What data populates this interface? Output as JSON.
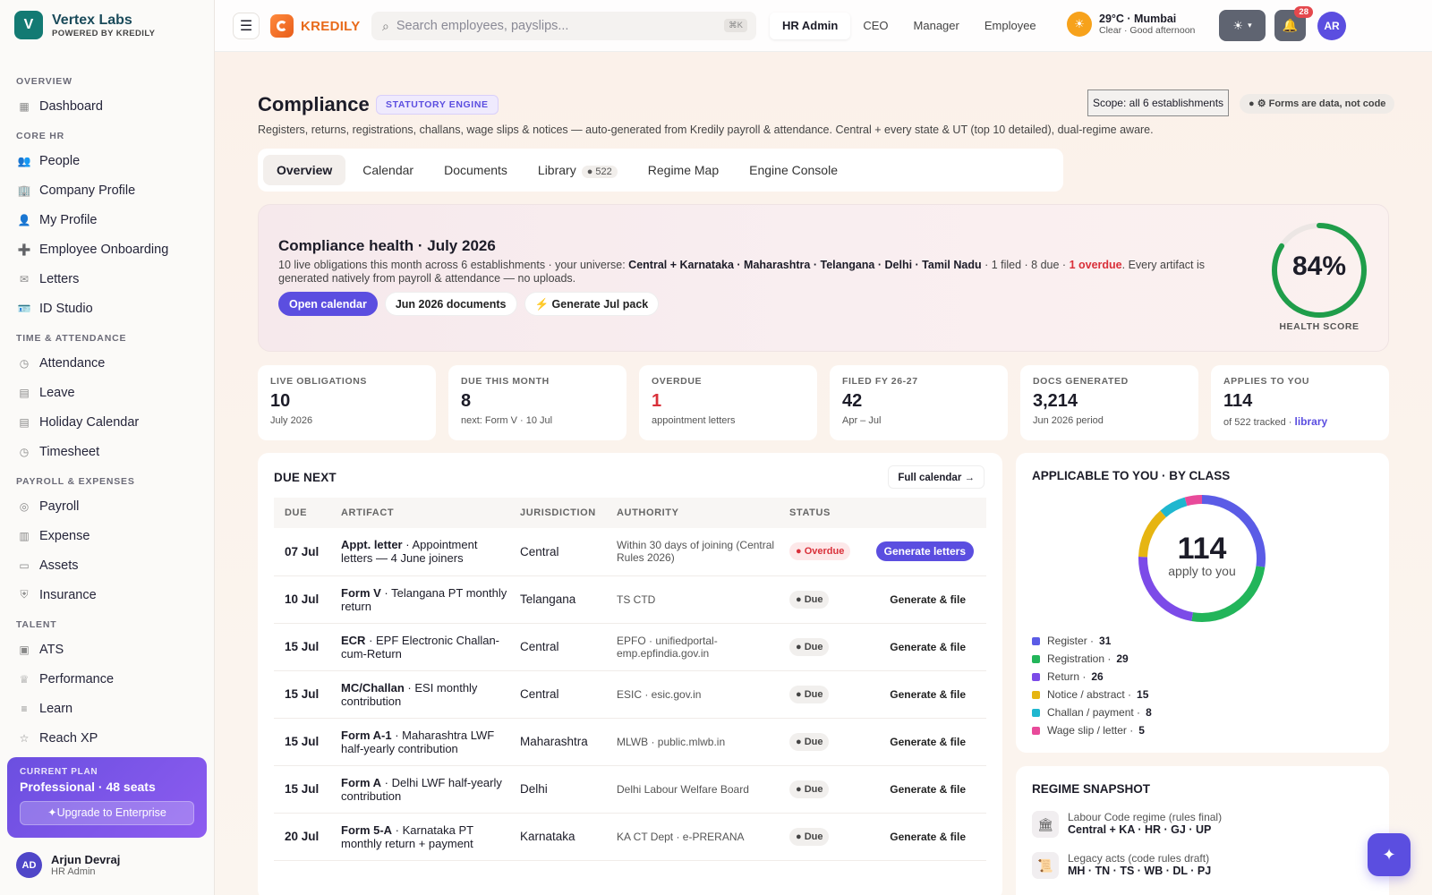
{
  "brand": {
    "logo_letter": "V",
    "name": "Vertex Labs",
    "sub": "POWERED BY KREDILY"
  },
  "nav": {
    "sections": [
      {
        "title": "OVERVIEW",
        "items": [
          {
            "label": "Dashboard",
            "icon": "grid-icon"
          }
        ]
      },
      {
        "title": "CORE HR",
        "items": [
          {
            "label": "People",
            "icon": "people-icon"
          },
          {
            "label": "Company Profile",
            "icon": "building-icon"
          },
          {
            "label": "My Profile",
            "icon": "user-icon"
          },
          {
            "label": "Employee Onboarding",
            "icon": "user-plus-icon"
          },
          {
            "label": "Letters",
            "icon": "mail-icon"
          },
          {
            "label": "ID Studio",
            "icon": "id-card-icon"
          }
        ]
      },
      {
        "title": "TIME & ATTENDANCE",
        "items": [
          {
            "label": "Attendance",
            "icon": "clock-icon"
          },
          {
            "label": "Leave",
            "icon": "calendar-icon"
          },
          {
            "label": "Holiday Calendar",
            "icon": "calendar-icon"
          },
          {
            "label": "Timesheet",
            "icon": "clock-icon"
          }
        ]
      },
      {
        "title": "PAYROLL & EXPENSES",
        "items": [
          {
            "label": "Payroll",
            "icon": "coin-icon"
          },
          {
            "label": "Expense",
            "icon": "receipt-icon"
          },
          {
            "label": "Assets",
            "icon": "monitor-icon"
          },
          {
            "label": "Insurance",
            "icon": "shield-icon"
          }
        ]
      },
      {
        "title": "TALENT",
        "items": [
          {
            "label": "ATS",
            "icon": "briefcase-icon"
          },
          {
            "label": "Performance",
            "icon": "trophy-icon"
          },
          {
            "label": "Learn",
            "icon": "book-icon"
          },
          {
            "label": "Reach XP",
            "icon": "star-icon"
          }
        ]
      }
    ]
  },
  "plan": {
    "label": "CURRENT PLAN",
    "name": "Professional · 48 seats",
    "button": "✦Upgrade to Enterprise"
  },
  "user": {
    "initials": "AD",
    "name": "Arjun Devraj",
    "role": "HR Admin"
  },
  "topbar": {
    "app_name": "KREDILY",
    "search_placeholder": "Search employees, payslips...",
    "search_shortcut": "⌘K",
    "roles": [
      "HR Admin",
      "CEO",
      "Manager",
      "Employee"
    ],
    "active_role": "HR Admin",
    "weather_main": "29°C · Mumbai",
    "weather_sub": "Clear · Good afternoon",
    "notifications": "28",
    "avatar": "AR"
  },
  "page": {
    "title": "Compliance",
    "tag": "STATUTORY ENGINE",
    "scope": "Scope: all 6 establishments",
    "forms_note": "● ⚙ Forms are data, not code",
    "subtitle": "Registers, returns, registrations, challans, wage slips & notices — auto-generated from Kredily payroll & attendance. Central + every state & UT (top 10 detailed), dual-regime aware.",
    "tabs": [
      "Overview",
      "Calendar",
      "Documents",
      "Library",
      "Regime Map",
      "Engine Console"
    ],
    "library_count": "● 522"
  },
  "health": {
    "title": "Compliance health · July 2026",
    "text_pre": "10 live obligations this month across 6 establishments · your universe: ",
    "text_bold": "Central + Karnataka · Maharashtra · Telangana · Delhi · Tamil Nadu",
    "text_mid": " · 1 filed · 8 due · ",
    "text_red": "1 overdue",
    "text_post": ". Every artifact is generated natively from payroll & attendance — no uploads.",
    "buttons": [
      "Open calendar",
      "Jun 2026 documents",
      "⚡ Generate Jul pack"
    ],
    "score": 84,
    "score_text": "84%",
    "score_label": "HEALTH SCORE",
    "score_color": "#1f9d4a"
  },
  "kpis": [
    {
      "label": "LIVE OBLIGATIONS",
      "value": "10",
      "sub": "July 2026"
    },
    {
      "label": "DUE THIS MONTH",
      "value": "8",
      "sub": "next: Form V · 10 Jul"
    },
    {
      "label": "OVERDUE",
      "value": "1",
      "sub": "appointment letters"
    },
    {
      "label": "FILED FY 26-27",
      "value": "42",
      "sub": "Apr – Jul"
    },
    {
      "label": "DOCS GENERATED",
      "value": "3,214",
      "sub": "Jun 2026 period"
    },
    {
      "label": "APPLIES TO YOU",
      "value": "114",
      "sub": "of 522 tracked · ",
      "link": "library"
    }
  ],
  "due_next": {
    "title": "DUE NEXT",
    "full_calendar": "Full calendar →",
    "columns": [
      "DUE",
      "ARTIFACT",
      "JURISDICTION",
      "AUTHORITY",
      "STATUS",
      ""
    ],
    "rows": [
      {
        "due": "07 Jul",
        "form": "Appt. letter",
        "desc": " · Appointment letters — 4 June joiners",
        "jurisdiction": "Central",
        "authority": "Within 30 days of joining (Central Rules 2026)",
        "status": "● Overdue",
        "overdue": true,
        "action": "Generate letters"
      },
      {
        "due": "10 Jul",
        "form": "Form V",
        "desc": " · Telangana PT monthly return",
        "jurisdiction": "Telangana",
        "authority": "TS CTD",
        "status": "● Due",
        "overdue": false,
        "action": "Generate & file"
      },
      {
        "due": "15 Jul",
        "form": "ECR",
        "desc": " · EPF Electronic Challan-cum-Return",
        "jurisdiction": "Central",
        "authority": "EPFO · unifiedportal-emp.epfindia.gov.in",
        "status": "● Due",
        "overdue": false,
        "action": "Generate & file"
      },
      {
        "due": "15 Jul",
        "form": "MC/Challan",
        "desc": " · ESI monthly contribution",
        "jurisdiction": "Central",
        "authority": "ESIC · esic.gov.in",
        "status": "● Due",
        "overdue": false,
        "action": "Generate & file"
      },
      {
        "due": "15 Jul",
        "form": "Form A-1",
        "desc": " · Maharashtra LWF half-yearly contribution",
        "jurisdiction": "Maharashtra",
        "authority": "MLWB · public.mlwb.in",
        "status": "● Due",
        "overdue": false,
        "action": "Generate & file"
      },
      {
        "due": "15 Jul",
        "form": "Form A",
        "desc": " · Delhi LWF half-yearly contribution",
        "jurisdiction": "Delhi",
        "authority": "Delhi Labour Welfare Board",
        "status": "● Due",
        "overdue": false,
        "action": "Generate & file"
      },
      {
        "due": "20 Jul",
        "form": "Form 5-A",
        "desc": " · Karnataka PT monthly return + payment",
        "jurisdiction": "Karnataka",
        "authority": "KA CT Dept · e-PRERANA",
        "status": "● Due",
        "overdue": false,
        "action": "Generate & file"
      }
    ]
  },
  "applicable": {
    "title": "APPLICABLE TO YOU · BY CLASS",
    "total": "114",
    "total_sub": "apply to you",
    "classes": [
      {
        "label": "Register ·",
        "value": 31,
        "color": "#5b5ce6"
      },
      {
        "label": "Registration ·",
        "value": 29,
        "color": "#22b55a"
      },
      {
        "label": "Return ·",
        "value": 26,
        "color": "#7c4be8"
      },
      {
        "label": "Notice / abstract ·",
        "value": 15,
        "color": "#e6b512"
      },
      {
        "label": "Challan / payment ·",
        "value": 8,
        "color": "#1fb7cf"
      },
      {
        "label": "Wage slip / letter ·",
        "value": 5,
        "color": "#e84a9a"
      }
    ]
  },
  "regime": {
    "title": "REGIME SNAPSHOT",
    "items": [
      {
        "label": "Labour Code regime (rules final)",
        "value": "Central + KA · HR · GJ · UP",
        "icon": "building-icon"
      },
      {
        "label": "Legacy acts (code rules draft)",
        "value": "MH · TN · TS · WB · DL · PJ",
        "icon": "scroll-icon"
      }
    ]
  }
}
